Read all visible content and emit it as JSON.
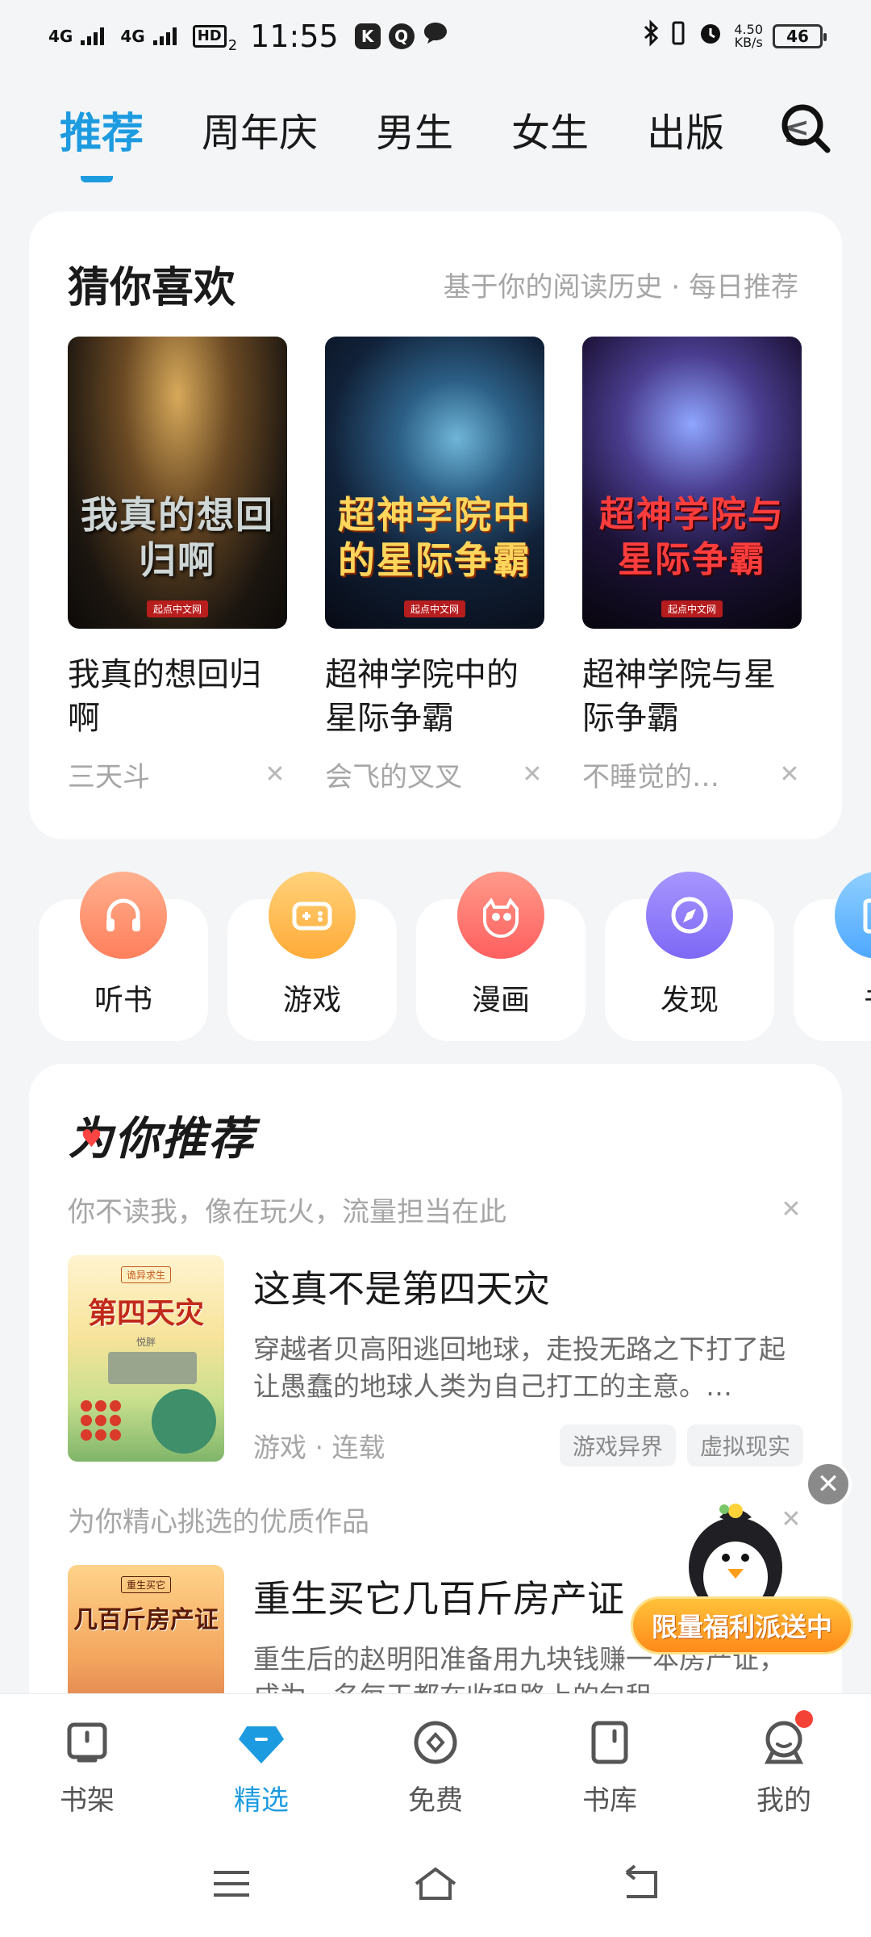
{
  "status_bar": {
    "network1": "4G",
    "network2": "4G",
    "hd": "HD",
    "hd_sub": "2",
    "time": "11:55",
    "app_icons": [
      "K",
      "Q"
    ],
    "speed_value": "4.50",
    "speed_unit": "KB/s",
    "battery": "46"
  },
  "top_tabs": [
    {
      "label": "推荐",
      "active": true
    },
    {
      "label": "周年庆"
    },
    {
      "label": "男生"
    },
    {
      "label": "女生"
    },
    {
      "label": "出版"
    },
    {
      "label": "≤"
    }
  ],
  "guess": {
    "title": "猜你喜欢",
    "subtitle": "基于你的阅读历史 · 每日推荐",
    "books": [
      {
        "cover_text": "我真的想回归啊",
        "title": "我真的想回归啊",
        "author": "三天斗"
      },
      {
        "cover_text": "超神学院中的星际争霸",
        "title": "超神学院中的星际争霸",
        "author": "会飞的叉叉"
      },
      {
        "cover_text": "超神学院与星际争霸",
        "title": "超神学院与星际争霸",
        "author": "不睡觉的…"
      }
    ],
    "publisher_mark": "起点中文网"
  },
  "quick_entries": [
    {
      "label": "听书",
      "icon": "headphones-icon",
      "color": "#ff8f6b"
    },
    {
      "label": "游戏",
      "icon": "gamepad-icon",
      "color": "#ffb84d"
    },
    {
      "label": "漫画",
      "icon": "comic-face-icon",
      "color": "#ff6f6f"
    },
    {
      "label": "发现",
      "icon": "compass-icon",
      "color": "#8e7bff"
    },
    {
      "label": "书",
      "icon": "book-icon",
      "color": "#6ab8ff"
    }
  ],
  "recommend": {
    "title": "为你推荐",
    "items": [
      {
        "reason": "你不读我，像在玩火，流量担当在此",
        "cover_small": "诡异求生",
        "cover_title": "第四天灾",
        "cover_author": "悦胖",
        "title": "这真不是第四天灾",
        "desc": "穿越者贝高阳逃回地球，走投无路之下打了起让愚蠢的地球人类为自己打工的主意。…",
        "meta": "游戏 · 连载",
        "tags": [
          "游戏异界",
          "虚拟现实"
        ]
      },
      {
        "reason": "为你精心挑选的优质作品",
        "cover_small": "重生买它",
        "cover_title": "几百斤房产证",
        "cover_author": "",
        "title": "重生买它几百斤房产证",
        "desc": "重生后的赵明阳准备用九块钱赚一本房产证，成为一名每天都在收租路上的包租…",
        "meta": "",
        "tags": []
      }
    ]
  },
  "promo": {
    "label": "限量福利派送中",
    "close": "✕"
  },
  "bottom_nav": [
    {
      "label": "书架",
      "icon": "bookshelf-icon"
    },
    {
      "label": "精选",
      "icon": "diamond-icon",
      "active": true
    },
    {
      "label": "免费",
      "icon": "free-coin-icon"
    },
    {
      "label": "书库",
      "icon": "library-icon"
    },
    {
      "label": "我的",
      "icon": "profile-icon",
      "badge": true
    }
  ],
  "system_nav": [
    "menu-icon",
    "home-icon",
    "back-icon"
  ],
  "colors": {
    "accent": "#1d9be0",
    "muted_text": "#a6a6a6",
    "badge_red": "#f44336",
    "promo_orange": "#ff8a1a"
  }
}
